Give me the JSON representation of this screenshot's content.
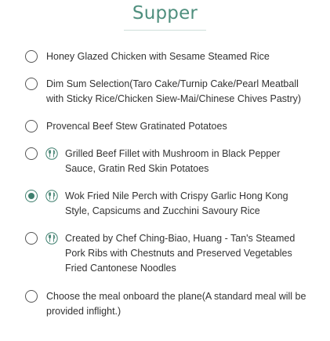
{
  "title": "Supper",
  "meals": [
    {
      "label": "Honey Glazed Chicken with Sesame Steamed Rice",
      "icon": null,
      "selected": false
    },
    {
      "label": "Dim Sum Selection(Taro Cake/Turnip Cake/Pearl Meatball with Sticky Rice/Chicken Siew-Mai/Chinese Chives Pastry)",
      "icon": null,
      "selected": false
    },
    {
      "label": "Provencal Beef Stew Gratinated Potatoes",
      "icon": null,
      "selected": false
    },
    {
      "label": "Grilled Beef Fillet with Mushroom in Black Pepper Sauce, Gratin Red Skin Potatoes",
      "icon": "fork-knife-icon",
      "selected": false
    },
    {
      "label": "Wok Fried Nile Perch with Crispy Garlic Hong Kong Style, Capsicums and Zucchini Savoury Rice",
      "icon": "fork-knife-icon",
      "selected": true
    },
    {
      "label": "Created by Chef Ching-Biao, Huang - Tan's Steamed Pork Ribs with Chestnuts and Preserved Vegetables Fried Cantonese Noodles",
      "icon": "fork-knife-icon",
      "selected": false
    },
    {
      "label": "Choose the meal onboard the plane(A standard meal will be provided inflight.)",
      "icon": null,
      "selected": false
    }
  ],
  "colors": {
    "accent": "#3f7f6e",
    "title": "#4f8f7e",
    "text": "#333333",
    "radio_border": "#555555"
  }
}
